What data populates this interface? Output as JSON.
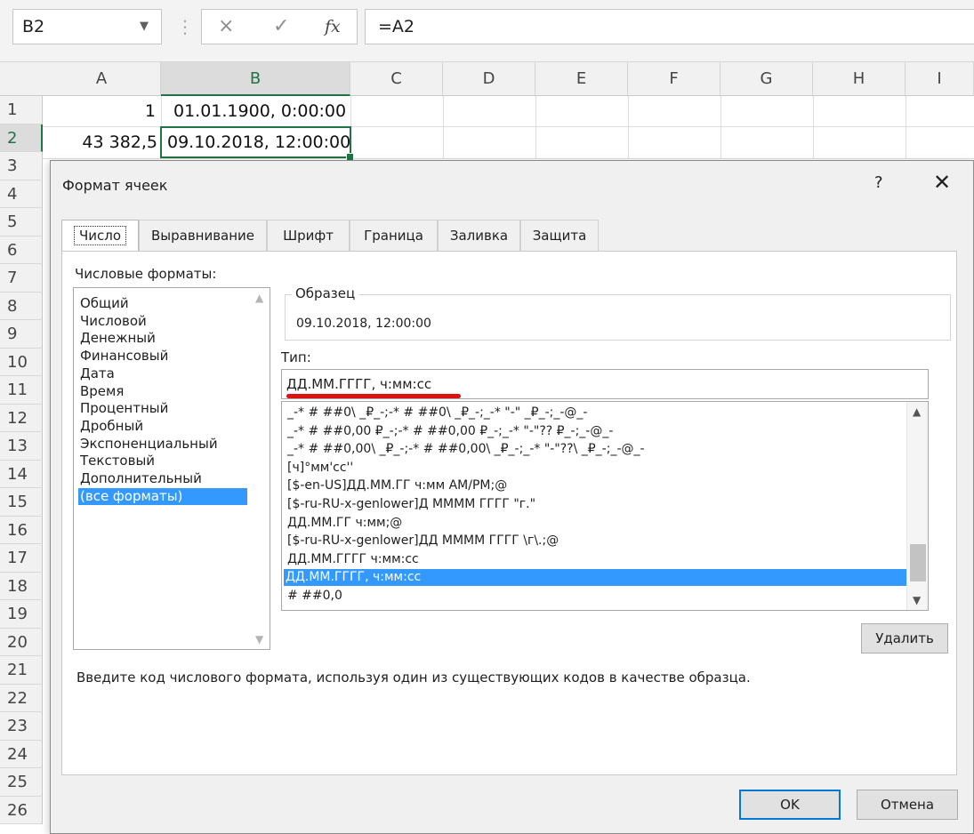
{
  "formula_bar": {
    "name_box": "B2",
    "cancel_icon": "×",
    "enter_icon": "✓",
    "fx_label": "fx",
    "formula": "=A2"
  },
  "grid": {
    "columns": [
      "A",
      "B",
      "C",
      "D",
      "E",
      "F",
      "G",
      "H",
      "I"
    ],
    "rows": [
      "1",
      "2",
      "3",
      "4",
      "5",
      "6",
      "7",
      "8",
      "9",
      "10",
      "11",
      "12",
      "13",
      "14",
      "15",
      "16",
      "17",
      "18",
      "19",
      "20",
      "21",
      "22",
      "23",
      "24",
      "25",
      "26"
    ],
    "active_cell": "B2",
    "cells": {
      "A1": "1",
      "B1": "01.01.1900, 0:00:00",
      "A2": "43 382,5",
      "B2": "09.10.2018, 12:00:00"
    },
    "accent_color": "#217346"
  },
  "dialog": {
    "title": "Формат ячеек",
    "help": "?",
    "close": "✕",
    "tabs": [
      "Число",
      "Выравнивание",
      "Шрифт",
      "Граница",
      "Заливка",
      "Защита"
    ],
    "active_tab": "Число",
    "categories_label": "Числовые форматы:",
    "categories": [
      "Общий",
      "Числовой",
      "Денежный",
      "Финансовый",
      "Дата",
      "Время",
      "Процентный",
      "Дробный",
      "Экспоненциальный",
      "Текстовый",
      "Дополнительный",
      "(все форматы)"
    ],
    "selected_category": "(все форматы)",
    "sample_label": "Образец",
    "sample_value": "09.10.2018, 12:00:00",
    "type_label": "Тип:",
    "type_value": "ДД.ММ.ГГГГ, ч:мм:сс",
    "format_codes": [
      "_-* # ##0\\ _₽_-;-* # ##0\\ _₽_-;_-* \"-\" _₽_-;_-@_-",
      "_-* # ##0,00 ₽_-;-* # ##0,00 ₽_-;_-* \"-\"?? ₽_-;_-@_-",
      "_-* # ##0,00\\ _₽_-;-* # ##0,00\\ _₽_-;_-* \"-\"??\\ _₽_-;_-@_-",
      "[ч]°мм'сс''",
      "[$-en-US]ДД.ММ.ГГ ч:мм AM/PM;@",
      "[$-ru-RU-x-genlower]Д ММММ ГГГГ \"г.\"",
      "ДД.ММ.ГГ ч:мм;@",
      "[$-ru-RU-x-genlower]ДД ММММ ГГГГ \\г\\.;@",
      "ДД.ММ.ГГГГ ч:мм:сс",
      "ДД.ММ.ГГГГ, ч:мм:сс",
      "# ##0,0"
    ],
    "selected_format": "ДД.ММ.ГГГГ, ч:мм:сс",
    "delete_button": "Удалить",
    "hint": "Введите код числового формата, используя один из существующих кодов в качестве образца.",
    "ok_button": "OK",
    "cancel_button": "Отмена",
    "selection_color": "#3399ff"
  }
}
